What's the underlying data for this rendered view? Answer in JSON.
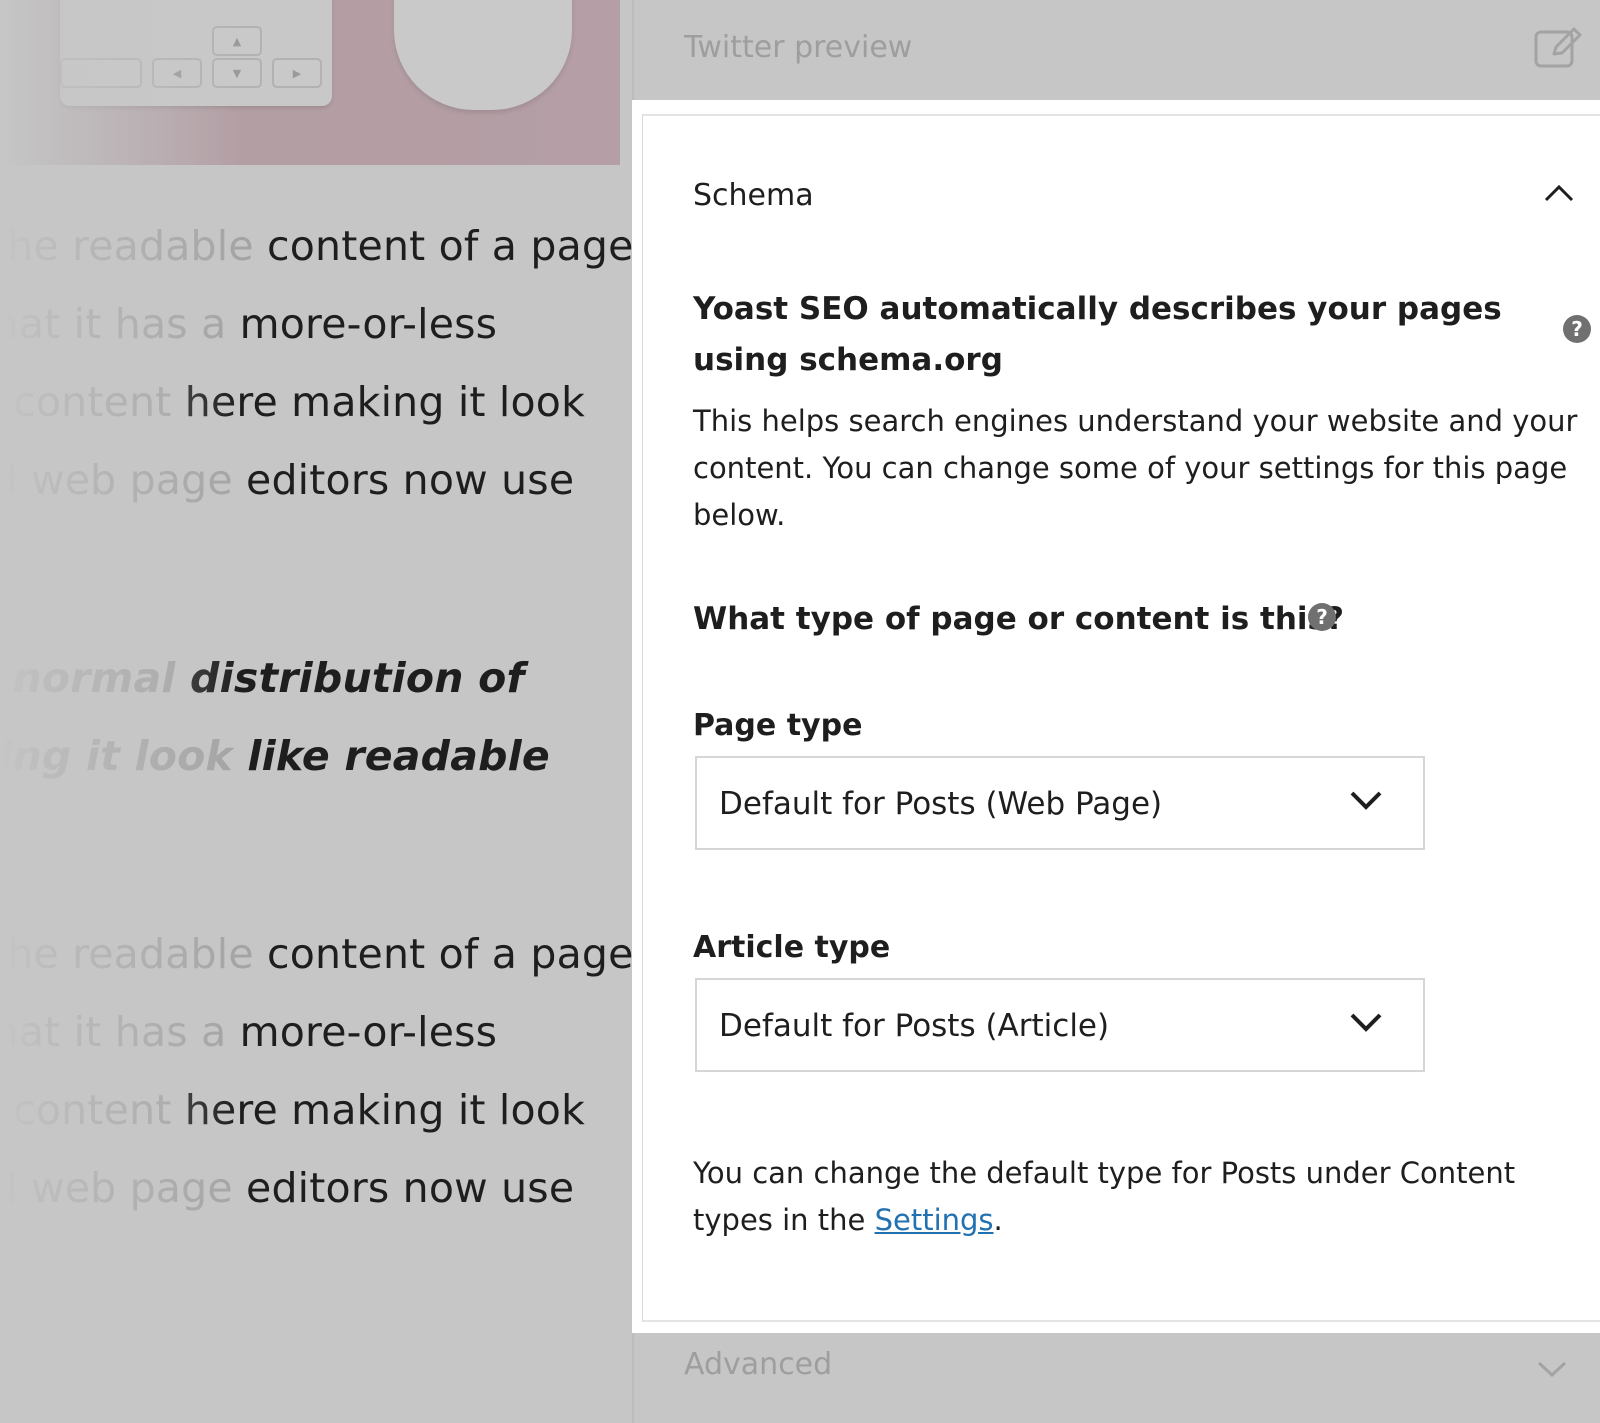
{
  "editor": {
    "lines": [
      {
        "ghost": "The readable",
        "text": " content of a page"
      },
      {
        "ghost": "is that it has a",
        "text": " more-or-less"
      },
      {
        "ghost": "of content",
        "text": " here making it look"
      },
      {
        "ghost": "and web page",
        "text": " editors now use"
      },
      {
        "ghost": "a normal",
        "text": " distribution of"
      },
      {
        "ghost": "making it look",
        "text": " like readable"
      },
      {
        "ghost": "The readable",
        "text": " content of a page"
      },
      {
        "ghost": "is that it has a",
        "text": " more-or-less"
      },
      {
        "ghost": "of content",
        "text": " here making it look"
      },
      {
        "ghost": "and web page",
        "text": " editors now use"
      }
    ],
    "keys": [
      "◀",
      "▲",
      "▼",
      "▶"
    ]
  },
  "sidebar": {
    "twitter_preview": "Twitter preview",
    "advanced": "Advanced",
    "schema": {
      "title": "Schema",
      "heading": "Yoast SEO automatically describes your pages using schema.org",
      "description": "This helps search engines understand your website and your content. You can change some of your settings for this page below.",
      "question": "What type of page or content is this?",
      "page_type": {
        "label": "Page type",
        "value": "Default for Posts (Web Page)"
      },
      "article_type": {
        "label": "Article type",
        "value": "Default for Posts (Article)"
      },
      "note_prefix": "You can change the default type for Posts under Content types in the ",
      "note_link": "Settings",
      "note_suffix": "."
    }
  },
  "colors": {
    "overlay": "#c6c6c6",
    "link": "#2271b1",
    "text": "#1e1e1e",
    "muted": "#9e9e9e"
  }
}
